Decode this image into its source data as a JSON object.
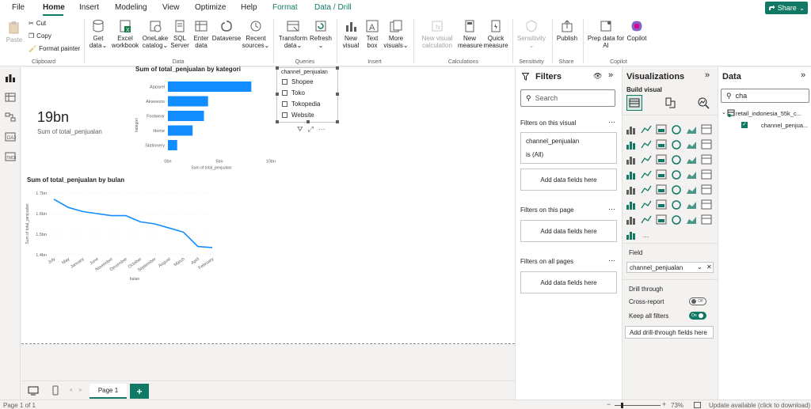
{
  "menu": {
    "file": "File",
    "home": "Home",
    "insert": "Insert",
    "modeling": "Modeling",
    "view": "View",
    "optimize": "Optimize",
    "help": "Help",
    "format": "Format",
    "data_drill": "Data / Drill",
    "share": "Share"
  },
  "ribbon": {
    "clipboard": {
      "paste": "Paste",
      "cut": "Cut",
      "copy": "Copy",
      "format_painter": "Format painter",
      "label": "Clipboard"
    },
    "data": {
      "get_data": [
        "Get",
        "data"
      ],
      "excel": [
        "Excel",
        "workbook"
      ],
      "onelake": [
        "OneLake",
        "catalog"
      ],
      "sql": [
        "SQL",
        "Server"
      ],
      "enter": [
        "Enter",
        "data"
      ],
      "dataverse": [
        "Dataverse"
      ],
      "recent": [
        "Recent",
        "sources"
      ],
      "label": "Data"
    },
    "queries": {
      "transform": [
        "Transform",
        "data"
      ],
      "refresh": [
        "Refresh"
      ],
      "label": "Queries"
    },
    "insert": {
      "new_visual": [
        "New",
        "visual"
      ],
      "text_box": [
        "Text",
        "box"
      ],
      "more_visuals": [
        "More",
        "visuals"
      ],
      "label": "Insert"
    },
    "calculations": {
      "new_visual_calc": [
        "New visual",
        "calculation"
      ],
      "new_measure": [
        "New",
        "measure"
      ],
      "quick_measure": [
        "Quick",
        "measure"
      ],
      "label": "Calculations"
    },
    "sensitivity": {
      "btn": [
        "Sensitivity"
      ],
      "label": "Sensitivity"
    },
    "share": {
      "publish": [
        "Publish"
      ],
      "label": "Share"
    },
    "copilot": {
      "prep": [
        "Prep data for",
        "AI"
      ],
      "copilot": [
        "Copilot"
      ],
      "label": "Copilot"
    }
  },
  "card": {
    "value": "19bn",
    "label": "Sum of total_penjualan"
  },
  "slicer": {
    "title": "channel_penjualan",
    "options": [
      "Shopee",
      "Toko",
      "Tokopedia",
      "Website"
    ]
  },
  "chart_data": [
    {
      "type": "bar",
      "title": "Sum of total_penjualan by kategori",
      "ylabel": "kategori",
      "xlabel": "Sum of total_penjualan",
      "categories": [
        "Apparel",
        "Aksesoris",
        "Footwear",
        "Home",
        "Stationery"
      ],
      "values": [
        8.1,
        3.9,
        3.5,
        2.4,
        0.9
      ],
      "xlim": [
        0,
        10
      ],
      "xticks": [
        "0bn",
        "5bn",
        "10bn"
      ],
      "orientation": "horizontal",
      "color": "#118dff"
    },
    {
      "type": "line",
      "title": "Sum of total_penjualan by bulan",
      "ylabel": "Sum of total_penjualan",
      "xlabel": "bulan",
      "categories": [
        "July",
        "May",
        "January",
        "June",
        "November",
        "December",
        "October",
        "September",
        "August",
        "March",
        "April",
        "February"
      ],
      "values": [
        1.67,
        1.63,
        1.61,
        1.6,
        1.59,
        1.59,
        1.56,
        1.55,
        1.53,
        1.51,
        1.44,
        1.435
      ],
      "ylim": [
        1.4,
        1.7
      ],
      "yticks": [
        "1.4bn",
        "1.5bn",
        "1.6bn",
        "1.7bn"
      ],
      "color": "#118dff"
    }
  ],
  "filters": {
    "title": "Filters",
    "search_placeholder": "Search",
    "on_visual": "Filters on this visual",
    "visual_field": "channel_penjualan",
    "visual_field_state": "is (All)",
    "add_here": "Add data fields here",
    "on_page": "Filters on this page",
    "on_all": "Filters on all pages"
  },
  "viz": {
    "title": "Visualizations",
    "build": "Build visual",
    "field_label": "Field",
    "field_value": "channel_penjualan",
    "drill": "Drill through",
    "cross_report": "Cross-report",
    "cross_state": "Off",
    "keep_filters": "Keep all filters",
    "keep_state": "On",
    "add_drill": "Add drill-through fields here",
    "more": "..."
  },
  "datapane": {
    "title": "Data",
    "search_value": "cha",
    "table": "retail_indonesia_55k_c...",
    "field": "channel_penjua..."
  },
  "pages": {
    "page1": "Page 1",
    "add": "+"
  },
  "status": {
    "page": "Page 1 of 1",
    "zoom": "73%",
    "update": "Update available (click to download)"
  },
  "colors": {
    "accent": "#117865",
    "bar": "#118dff"
  }
}
